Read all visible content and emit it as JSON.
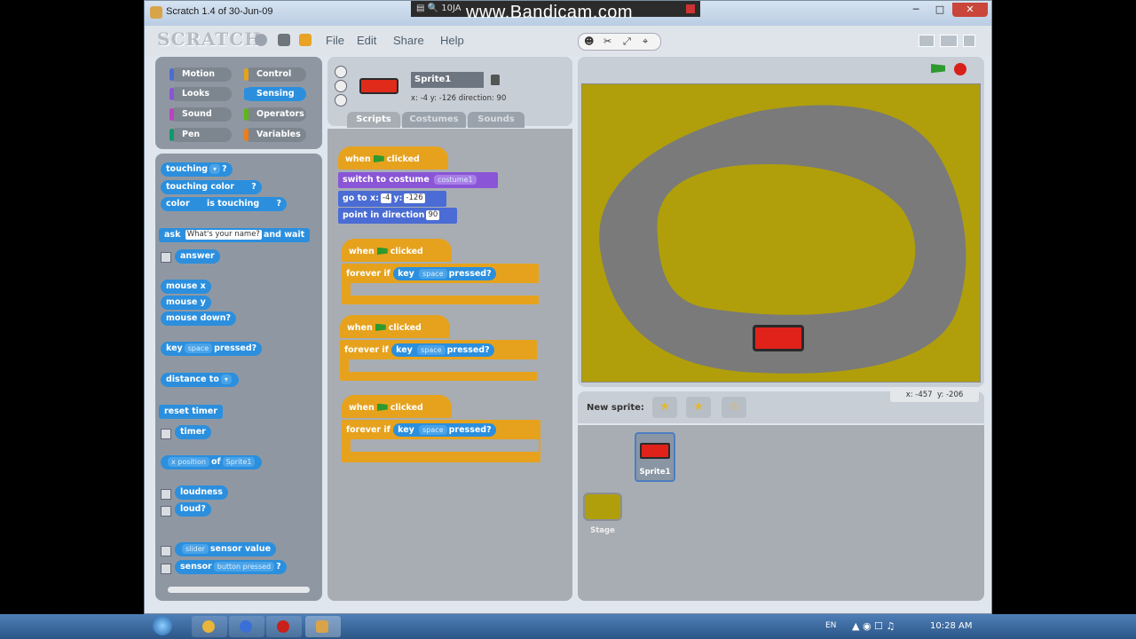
{
  "window": {
    "title": "Scratch 1.4 of 30-Jun-09",
    "watermark": "www.Bandicam.com",
    "recorder_status": "10JA"
  },
  "menubar": {
    "logo": "SCRATCH",
    "menus": [
      "File",
      "Edit",
      "Share",
      "Help"
    ]
  },
  "categories": [
    {
      "label": "Motion",
      "color": "#4a6cd4"
    },
    {
      "label": "Control",
      "color": "#e6a21d"
    },
    {
      "label": "Looks",
      "color": "#8a55d7"
    },
    {
      "label": "Sensing",
      "color": "#2b8fde",
      "selected": true
    },
    {
      "label": "Sound",
      "color": "#bb42c3"
    },
    {
      "label": "Operators",
      "color": "#5cb712"
    },
    {
      "label": "Pen",
      "color": "#0e9a6c"
    },
    {
      "label": "Variables",
      "color": "#ee7d16"
    }
  ],
  "palette": {
    "touching": "touching",
    "touching_color": "touching color",
    "color_label": "color",
    "is_touching": "is touching",
    "ask": "ask",
    "ask_default": "What's your name?",
    "and_wait": "and wait",
    "answer": "answer",
    "mouse_x": "mouse x",
    "mouse_y": "mouse y",
    "mouse_down": "mouse down?",
    "key": "key",
    "space": "space",
    "pressed": "pressed?",
    "distance_to": "distance to",
    "reset_timer": "reset timer",
    "timer": "timer",
    "x_position": "x position",
    "of": "of",
    "sprite1": "Sprite1",
    "loudness": "loudness",
    "loud": "loud?",
    "slider": "slider",
    "sensor_value": "sensor value",
    "sensor": "sensor",
    "button_pressed": "button pressed",
    "question": "?"
  },
  "sprite": {
    "name": "Sprite1",
    "info": "x: -4   y: -126  direction: 90"
  },
  "tabs": [
    "Scripts",
    "Costumes",
    "Sounds"
  ],
  "scripts": {
    "when": "when",
    "clicked": "clicked",
    "switch_to_costume": "switch to costume",
    "costume_value": "costume1",
    "go_to_x": "go to x:",
    "x_value": "-4",
    "y_label": "y:",
    "y_value": "-126",
    "point_in_direction": "point in direction",
    "direction_value": "90",
    "forever_if": "forever if",
    "key": "key",
    "space": "space",
    "pressed": "pressed?"
  },
  "stage": {
    "mouse_readout_x": "x: -457",
    "mouse_readout_y": "y: -206"
  },
  "sprites_panel": {
    "new_sprite": "New sprite:",
    "sprite_label": "Sprite1",
    "stage_label": "Stage"
  },
  "taskbar": {
    "language": "EN",
    "clock": "10:28 AM"
  }
}
